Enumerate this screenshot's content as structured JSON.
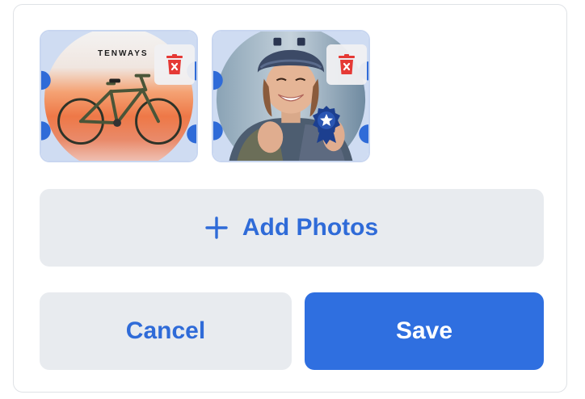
{
  "photos": [
    {
      "subject": "bicycle",
      "brand_text": "TENWAYS",
      "delete_icon": "trash-x-icon"
    },
    {
      "subject": "cyclist-woman-helmet",
      "badge_icon": "award-ribbon-star-icon",
      "delete_icon": "trash-x-icon"
    }
  ],
  "actions": {
    "add_photos_label": "Add Photos",
    "add_icon": "plus-icon",
    "cancel_label": "Cancel",
    "save_label": "Save"
  },
  "colors": {
    "accent": "#2f6fe0",
    "accent_text": "#2f6bd8",
    "secondary_bg": "#e8ebef",
    "delete_red": "#e53935",
    "badge_navy": "#1c3f8f"
  }
}
